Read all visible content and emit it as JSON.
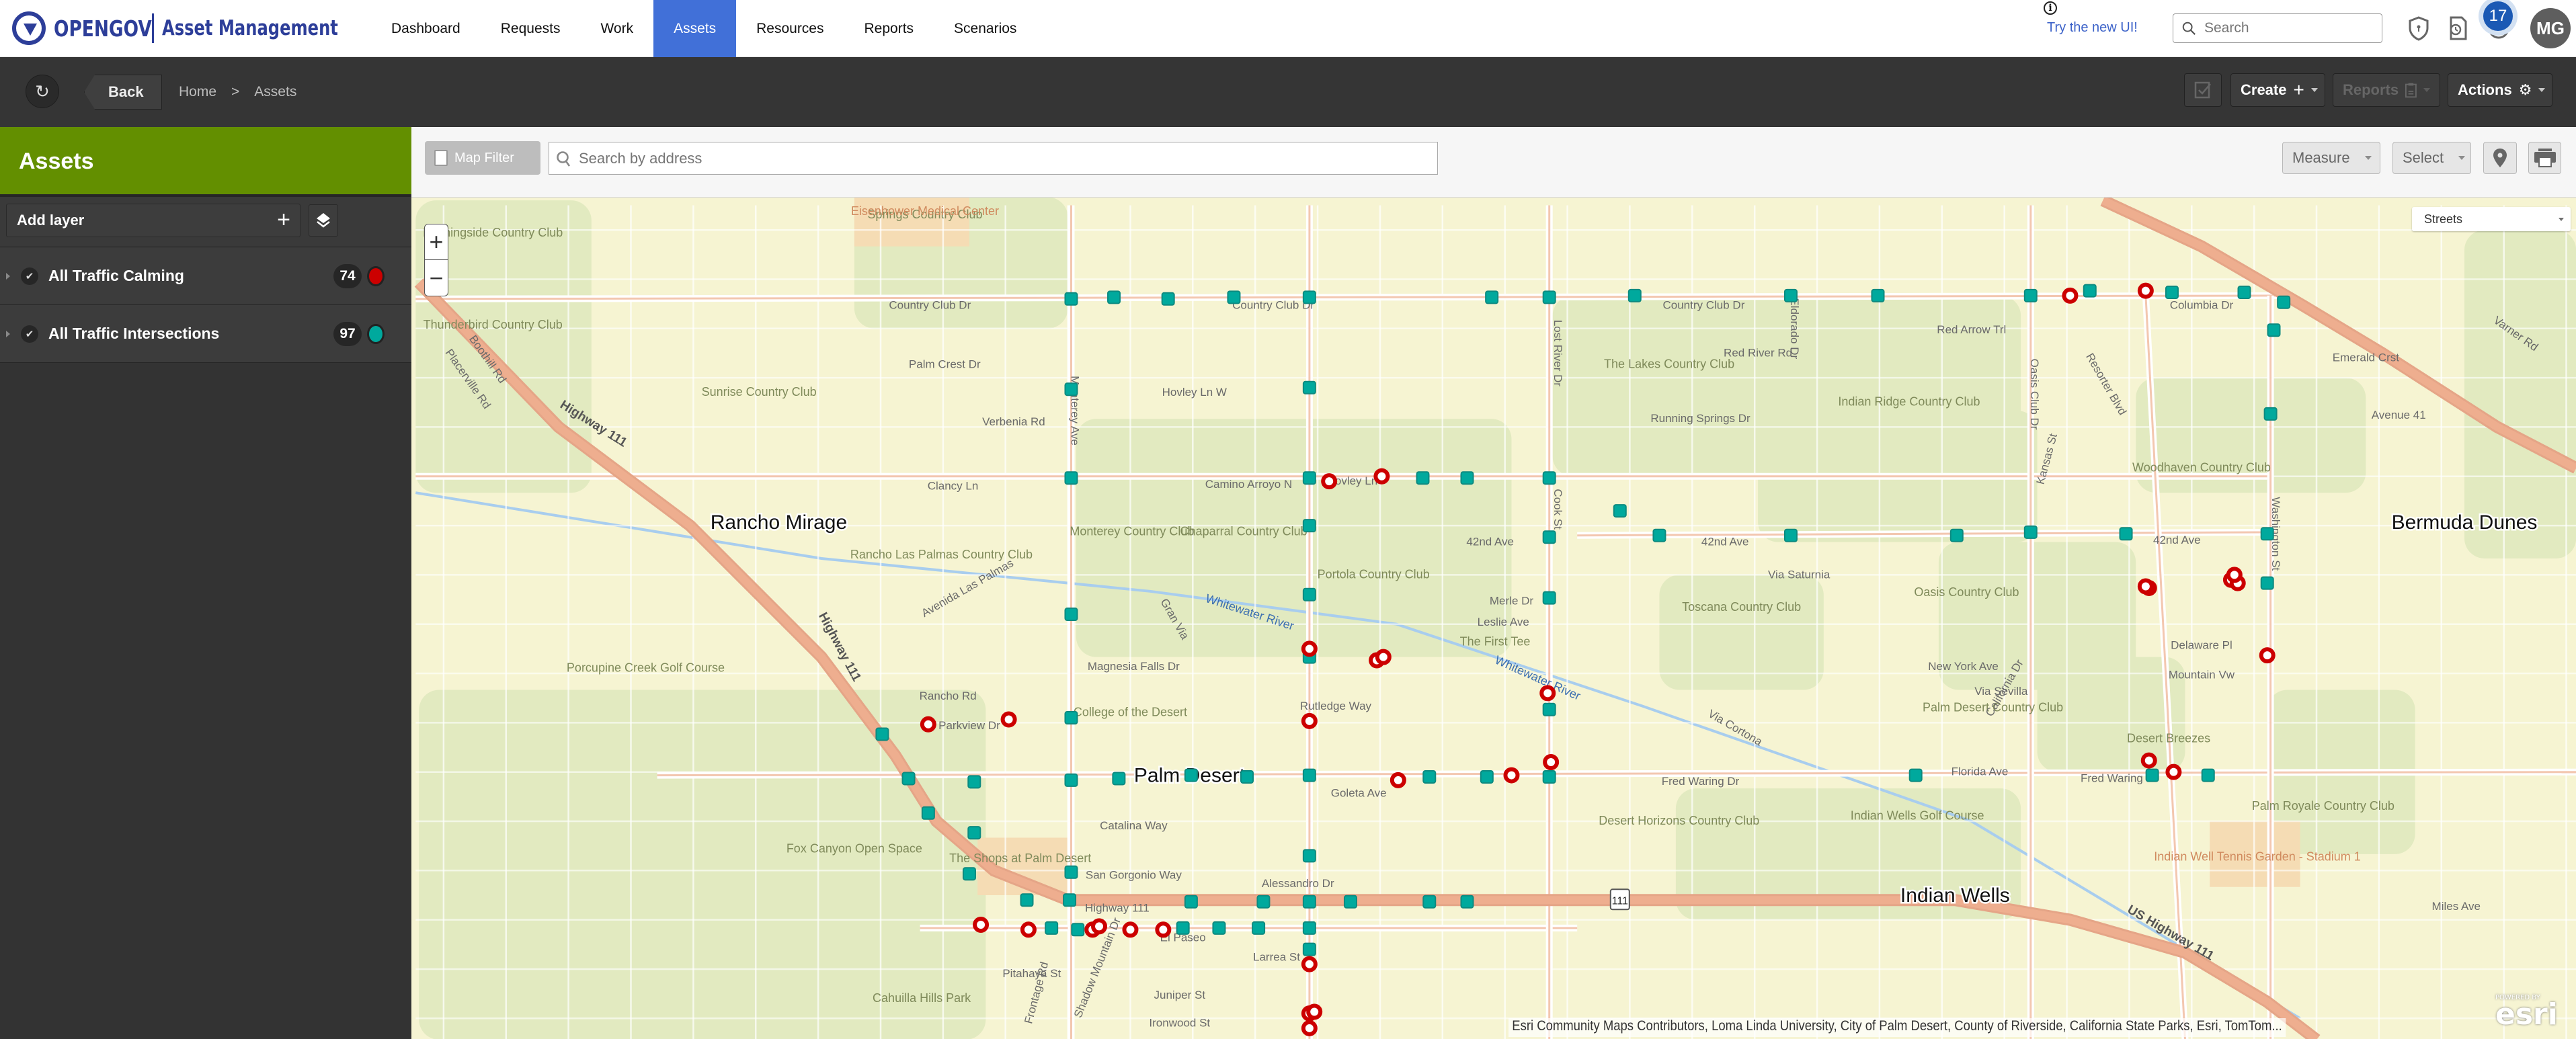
{
  "app": {
    "brand": "OPENGOV",
    "product": "Asset Management"
  },
  "nav": {
    "items": [
      {
        "label": "Dashboard"
      },
      {
        "label": "Requests"
      },
      {
        "label": "Work"
      },
      {
        "label": "Assets",
        "active": true
      },
      {
        "label": "Resources"
      },
      {
        "label": "Reports"
      },
      {
        "label": "Scenarios"
      }
    ],
    "try_new_ui": "Try the new UI!",
    "search_placeholder": "Search",
    "notification_count": "17",
    "user_initials": "MG"
  },
  "subbar": {
    "back_label": "Back",
    "breadcrumb": [
      "Home",
      ">",
      "Assets"
    ],
    "create_label": "Create",
    "reports_label": "Reports",
    "actions_label": "Actions"
  },
  "sidebar": {
    "title": "Assets",
    "add_layer_label": "Add layer",
    "layers": [
      {
        "name": "All Traffic Calming",
        "count": "74",
        "color": "#cc0000",
        "checked": true
      },
      {
        "name": "All Traffic Intersections",
        "count": "97",
        "color": "#00a99d",
        "checked": true
      }
    ]
  },
  "map_toolbar": {
    "map_filter_label": "Map Filter",
    "address_placeholder": "Search by address",
    "measure_label": "Measure",
    "select_label": "Select"
  },
  "map": {
    "basemap": "Streets",
    "attribution": "Esri Community Maps Contributors, Loma Linda University, City of Palm Desert, County of Riverside, California State Parks, Esri, TomTom...",
    "powered_by": "POWERED BY",
    "esri_logo": "esri",
    "colors": {
      "calming": "#cc0000",
      "intersection": "#00a99d",
      "highway": "#eeae8f",
      "park": "#e2eac0",
      "water": "#a8cdee",
      "land": "#f6f4d2"
    },
    "places": [
      "Rancho Mirage",
      "Palm Desert",
      "Indian Wells",
      "Bermuda Dunes"
    ],
    "areas": [
      "Morningside Country Club",
      "Springs Country Club",
      "Eisenhower Medical Center",
      "Thunderbird Country Club",
      "Sunrise Country Club",
      "The Lakes Country Club",
      "Indian Ridge Country Club",
      "Woodhaven Country Club",
      "Monterey Country Club",
      "Chaparral Country Club",
      "Rancho Las Palmas Country Club",
      "Portola Country Club",
      "Oasis Country Club",
      "Toscana Country Club",
      "The First Tee",
      "College of the Desert",
      "Porcupine Creek Golf Course",
      "Fox Canyon Open Space",
      "The Shops at Palm Desert",
      "Cahuilla Hills Park",
      "Desert Horizons Country Club",
      "Indian Wells Golf Course",
      "Palm Desert Country Club",
      "Desert Breezes",
      "Palm Royale Country Club",
      "Indian Well Tennis Garden - Stadium 1"
    ],
    "streets": [
      "Country Club Dr",
      "Columbia Dr",
      "Palm Crest Dr",
      "Hovley Ln W",
      "Verbenia Rd",
      "Clancy Ln",
      "Camino Arroyo N",
      "Hovley Ln",
      "42nd Ave",
      "Merle Dr",
      "Leslie Ave",
      "Magnesia Falls Dr",
      "Rutledge Way",
      "Parkview Dr",
      "Rancho Rd",
      "Fred Waring Dr",
      "Goleta Ave",
      "Catalina Way",
      "San Gorgonio Way",
      "Alessandro Dr",
      "Highway 111",
      "US Highway 111",
      "El Paseo",
      "Larrea St",
      "Juniper St",
      "Ironwood St",
      "Pitahaya St",
      "Shadow Mountain Dr",
      "Frontage Rd",
      "Monterey Ave",
      "Cook St",
      "Lost River Dr",
      "Eldorado Dr",
      "Oasis Club Dr",
      "Washington St",
      "Kansas St",
      "Resorter Blvd",
      "Red Arrow Trl",
      "Red River Rd",
      "Running Springs Dr",
      "Emerald Crst",
      "Avenue 41",
      "Varner Rd",
      "Via Saturnia",
      "Via Cortona",
      "Florida Ave",
      "California Dr",
      "New York Ave",
      "Miles Ave",
      "Via Sevilla",
      "Mountain Vw",
      "Delaware Pl",
      "Gran Via",
      "Avenida Las Palmas",
      "Boothill Rd",
      "Placerville Rd",
      "Whitewater River"
    ],
    "shield": "111"
  }
}
